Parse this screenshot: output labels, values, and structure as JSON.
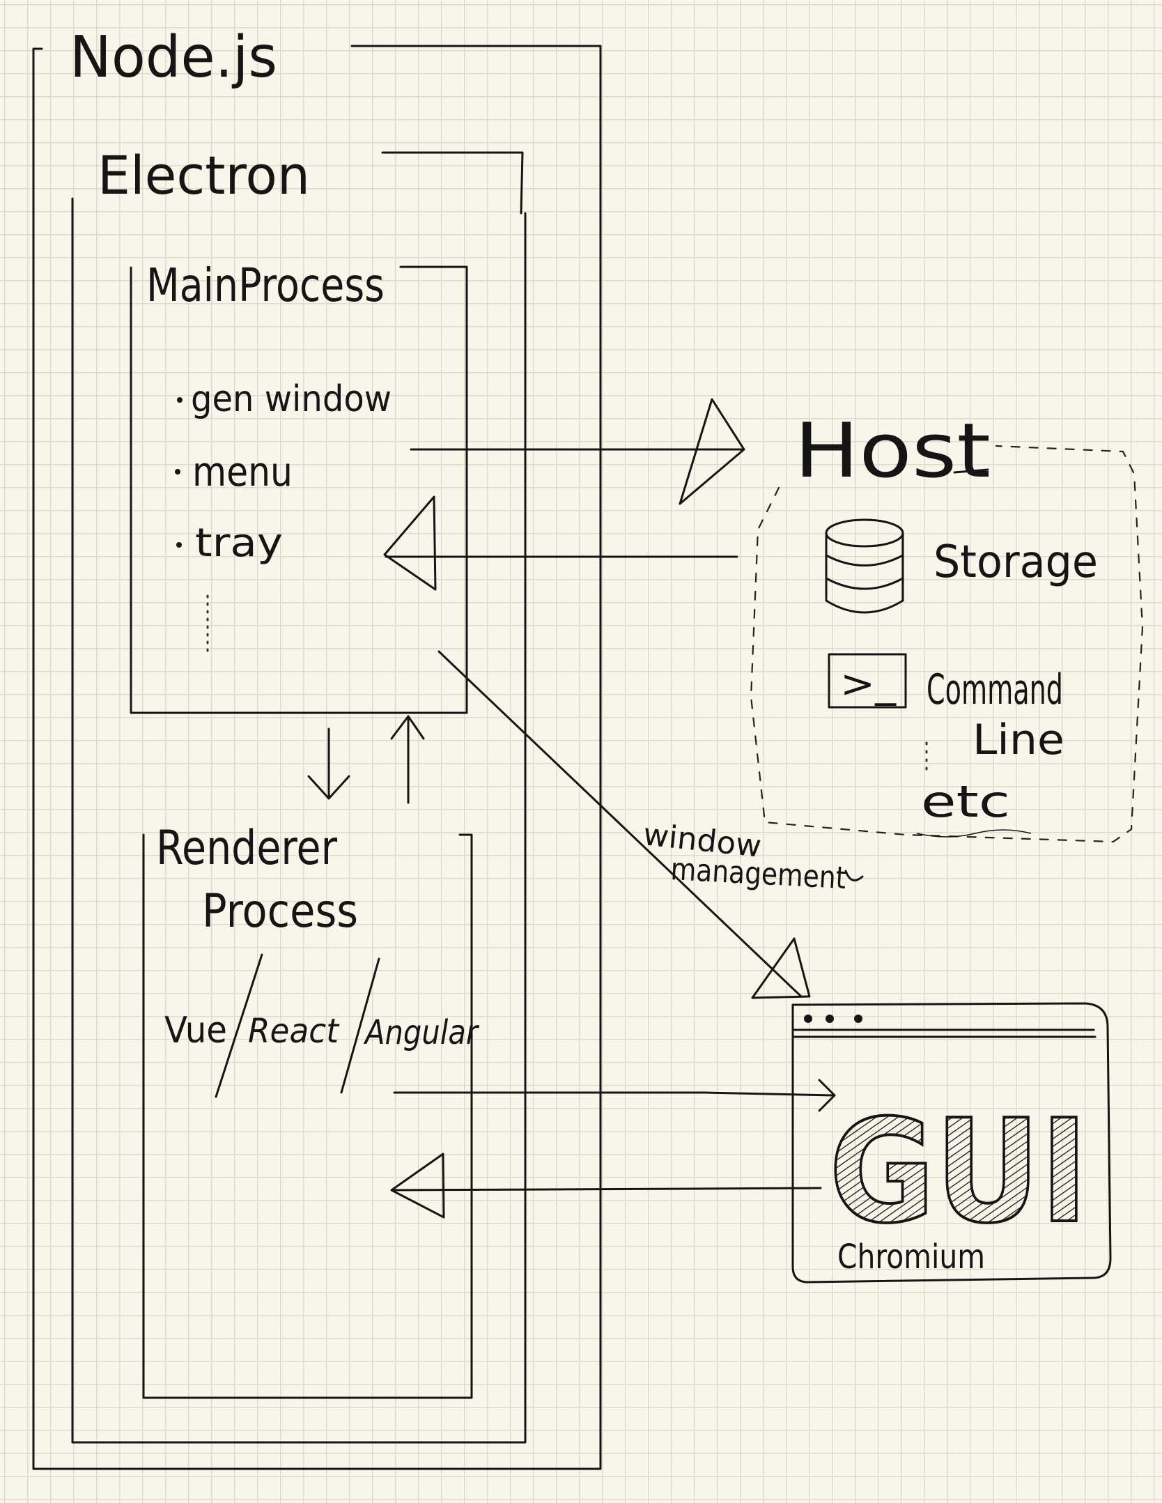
{
  "nodejs": {
    "label": "Node.js"
  },
  "electron": {
    "label": "Electron"
  },
  "main_process": {
    "label": "MainProcess",
    "items": [
      "gen window",
      "menu",
      "tray"
    ]
  },
  "renderer_process": {
    "label_line1": "Renderer",
    "label_line2": "Process",
    "frameworks": [
      "Vue",
      "React",
      "Angular"
    ]
  },
  "host": {
    "label": "Host",
    "storage_label": "Storage",
    "command_line_label_1": "Command",
    "command_line_label_2": "Line",
    "etc_label": "etc",
    "terminal_prompt": ">_"
  },
  "gui": {
    "label": "GUI",
    "sub_label": "Chromium"
  },
  "connections": {
    "window_management_1": "window",
    "window_management_2": "management"
  }
}
